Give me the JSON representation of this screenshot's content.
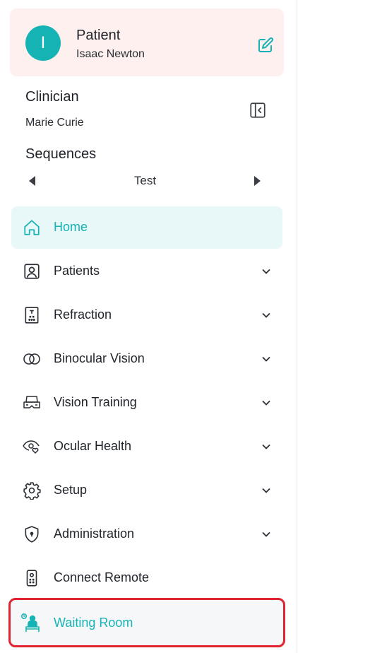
{
  "patient": {
    "avatar_initial": "I",
    "title": "Patient",
    "name": "Isaac Newton"
  },
  "clinician": {
    "title": "Clinician",
    "name": "Marie Curie"
  },
  "sequences": {
    "title": "Sequences",
    "current": "Test"
  },
  "nav": {
    "items": [
      {
        "label": "Home",
        "icon": "home-icon",
        "active": true
      },
      {
        "label": "Patients",
        "icon": "patient-icon",
        "expandable": true
      },
      {
        "label": "Refraction",
        "icon": "eye-chart-icon",
        "expandable": true
      },
      {
        "label": "Binocular Vision",
        "icon": "binocular-icon",
        "expandable": true
      },
      {
        "label": "Vision Training",
        "icon": "vr-headset-icon",
        "expandable": true
      },
      {
        "label": "Ocular Health",
        "icon": "eye-heart-icon",
        "expandable": true
      },
      {
        "label": "Setup",
        "icon": "gear-icon",
        "expandable": true
      },
      {
        "label": "Administration",
        "icon": "shield-icon",
        "expandable": true
      },
      {
        "label": "Connect Remote",
        "icon": "remote-icon"
      },
      {
        "label": "Waiting Room",
        "icon": "waiting-room-icon",
        "highlighted": true
      }
    ]
  },
  "colors": {
    "accent": "#16b3b5",
    "patient_card_bg": "#fdf0ee",
    "active_bg": "#e8f8f9",
    "highlight_border": "#e0242f"
  }
}
